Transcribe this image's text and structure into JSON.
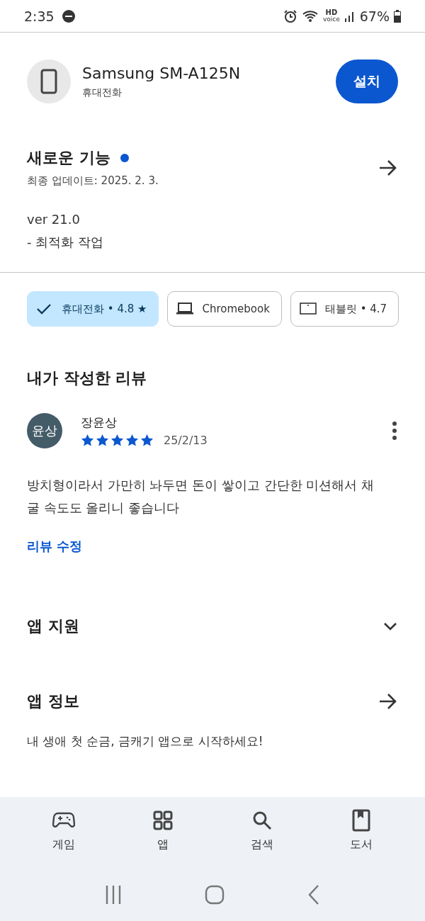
{
  "status_bar": {
    "time": "2:35",
    "battery": "67%",
    "hd_label": "HD",
    "voice_label": "voice"
  },
  "device": {
    "name": "Samsung SM-A125N",
    "type": "휴대전화",
    "install_button": "설치"
  },
  "whats_new": {
    "title": "새로운 기능",
    "new_dot": true,
    "updated": "최종 업데이트: 2025. 2. 3.",
    "notes": [
      "ver 21.0",
      "- 최적화 작업"
    ]
  },
  "device_chips": [
    {
      "kind": "phone",
      "label": "휴대전화 • 4.8 ★",
      "selected": true
    },
    {
      "kind": "laptop",
      "label": "Chromebook",
      "selected": false
    },
    {
      "kind": "tablet",
      "label": "태블릿 • 4.7",
      "selected": false
    }
  ],
  "my_review": {
    "heading": "내가 작성한 리뷰",
    "avatar_text": "윤상",
    "author": "장윤상",
    "stars": 5,
    "date": "25/2/13",
    "text": "방치형이라서 가만히 놔두면 돈이 쌓이고 간단한 미션해서 채굴 속도도 올리니 좋습니다",
    "edit_link": "리뷰 수정"
  },
  "sections": [
    {
      "kind": "expand",
      "title": "앱 지원",
      "expanded": false
    },
    {
      "kind": "link",
      "title": "앱 정보",
      "description": "내 생애 첫 순금, 금캐기 앱으로 시작하세요!"
    }
  ],
  "bottom_nav": [
    {
      "kind": "games",
      "label": "게임",
      "selected": false
    },
    {
      "kind": "apps",
      "label": "앱",
      "selected": false
    },
    {
      "kind": "search",
      "label": "검색",
      "selected": false
    },
    {
      "kind": "books",
      "label": "도서",
      "selected": false
    }
  ]
}
